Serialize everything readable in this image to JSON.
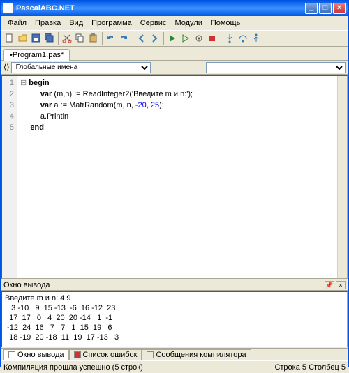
{
  "window": {
    "title": "PascalABC.NET"
  },
  "menu": {
    "items": [
      "Файл",
      "Правка",
      "Вид",
      "Программа",
      "Сервис",
      "Модули",
      "Помощь"
    ]
  },
  "tabs": {
    "current": "•Program1.pas*"
  },
  "nav": {
    "scope": "Глобальные имена"
  },
  "code": {
    "kw_begin": "begin",
    "kw_var1": "var",
    "kw_var2": "var",
    "kw_end": "end",
    "decl1": " (m,n) := ReadInteger2(",
    "str1": "'Введите m и n:'",
    "close1": ");",
    "decl2": " a := MatrRandom(m, n, ",
    "n1": "-20",
    "comma": ", ",
    "n2": "25",
    "close2": ");",
    "line4": "a.Println",
    "dot": "."
  },
  "lines": {
    "l1": "1",
    "l2": "2",
    "l3": "3",
    "l4": "4",
    "l5": "5"
  },
  "output_panel": {
    "caption": "Окно вывода"
  },
  "output": {
    "prompt": "Введите m и n: 4 9",
    "r1": "   3 -10   9  15 -13  -6  16 -12  23",
    "r2": "  17  17   0   4  20  20 -14   1  -1",
    "r3": " -12  24  16   7   7   1  15  19   6",
    "r4": "  18 -19  20 -18  11  19  17 -13   3"
  },
  "outtabs": {
    "t1": "Окно вывода",
    "t2": "Список ошибок",
    "t3": "Сообщения компилятора"
  },
  "status": {
    "msg": "Компиляция прошла успешно (5 строк)",
    "pos": "Строка  5  Столбец  5"
  }
}
